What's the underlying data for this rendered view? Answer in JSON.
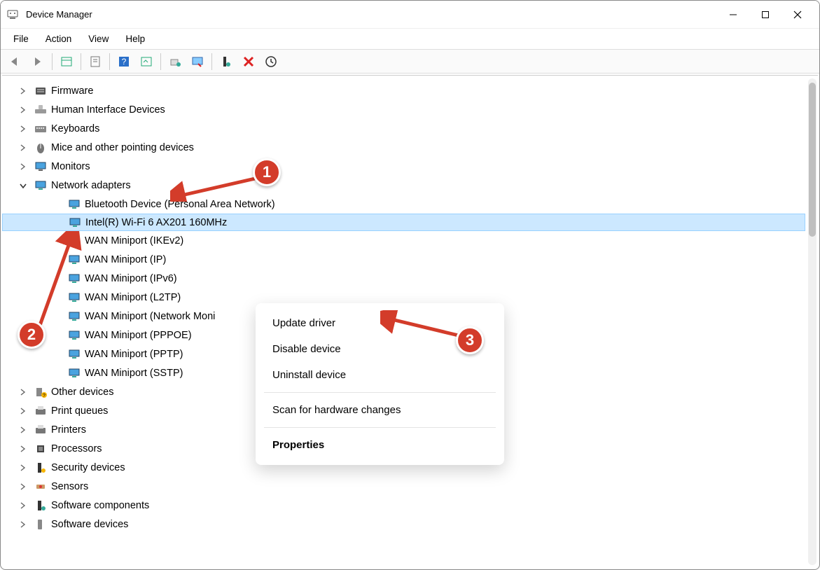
{
  "window": {
    "title": "Device Manager"
  },
  "menu": {
    "file": "File",
    "action": "Action",
    "view": "View",
    "help": "Help"
  },
  "tree": {
    "firmware": "Firmware",
    "hid": "Human Interface Devices",
    "keyboards": "Keyboards",
    "mice": "Mice and other pointing devices",
    "monitors": "Monitors",
    "network": "Network adapters",
    "net_children": {
      "bt": "Bluetooth Device (Personal Area Network)",
      "wifi": "Intel(R) Wi-Fi 6 AX201 160MHz",
      "ikev2": "WAN Miniport (IKEv2)",
      "ip": "WAN Miniport (IP)",
      "ipv6": "WAN Miniport (IPv6)",
      "l2tp": "WAN Miniport (L2TP)",
      "netmon": "WAN Miniport (Network Moni",
      "pppoe": "WAN Miniport (PPPOE)",
      "pptp": "WAN Miniport (PPTP)",
      "sstp": "WAN Miniport (SSTP)"
    },
    "other": "Other devices",
    "printq": "Print queues",
    "printers": "Printers",
    "processors": "Processors",
    "security": "Security devices",
    "sensors": "Sensors",
    "swcomp": "Software components",
    "swdev": "Software devices"
  },
  "context": {
    "update": "Update driver",
    "disable": "Disable device",
    "uninstall": "Uninstall device",
    "scan": "Scan for hardware changes",
    "properties": "Properties"
  },
  "badges": {
    "b1": "1",
    "b2": "2",
    "b3": "3"
  }
}
